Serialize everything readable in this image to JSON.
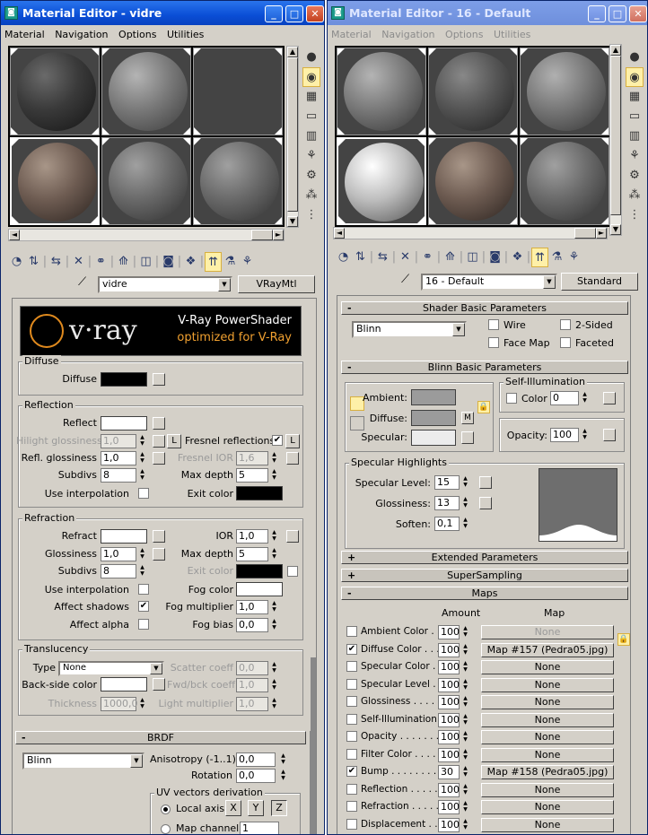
{
  "left": {
    "title": "Material Editor - vidre",
    "menu": [
      "Material",
      "Navigation",
      "Options",
      "Utilities"
    ],
    "material_name": "vidre",
    "material_type": "VRayMtl",
    "banner": {
      "logo": "v·ray",
      "title": "V-Ray PowerShader",
      "subtitle": "optimized for V-Ray"
    },
    "diffuse": {
      "group": "Diffuse",
      "label": "Diffuse"
    },
    "reflection": {
      "group": "Reflection",
      "reflect": "Reflect",
      "hilight_label": "Hilight glossiness",
      "hilight_value": "1,0",
      "refl_label": "Refl. glossiness",
      "refl_value": "1,0",
      "subdivs_label": "Subdivs",
      "subdivs_value": "8",
      "use_interp": "Use interpolation",
      "fresnel": "Fresnel reflections",
      "fresnel_ior_label": "Fresnel IOR",
      "fresnel_ior_value": "1,6",
      "max_depth_label": "Max depth",
      "max_depth_value": "5",
      "exit_color": "Exit color",
      "lock_l": "L"
    },
    "refraction": {
      "group": "Refraction",
      "refract": "Refract",
      "ior_label": "IOR",
      "ior_value": "1,0",
      "gloss_label": "Glossiness",
      "gloss_value": "1,0",
      "max_depth_label": "Max depth",
      "max_depth_value": "5",
      "subdivs_label": "Subdivs",
      "subdivs_value": "8",
      "exit_color": "Exit color",
      "use_interp": "Use interpolation",
      "fog_color": "Fog color",
      "affect_shadows": "Affect shadows",
      "fog_mult_label": "Fog multiplier",
      "fog_mult_value": "1,0",
      "affect_alpha": "Affect alpha",
      "fog_bias_label": "Fog bias",
      "fog_bias_value": "0,0"
    },
    "translucency": {
      "group": "Translucency",
      "type_label": "Type",
      "type_value": "None",
      "scatter_label": "Scatter coeff",
      "scatter_value": "0,0",
      "backside_label": "Back-side color",
      "fwd_label": "Fwd/bck coeff",
      "fwd_value": "1,0",
      "thickness_label": "Thickness",
      "thickness_value": "1000,0",
      "light_mult_label": "Light multiplier",
      "light_mult_value": "1,0"
    },
    "brdf": {
      "header": "BRDF",
      "toggle": "-",
      "type_value": "Blinn",
      "aniso_label": "Anisotropy (-1..1)",
      "aniso_value": "0,0",
      "rotation_label": "Rotation",
      "rotation_value": "0,0",
      "uv_group": "UV vectors derivation",
      "local_axis": "Local axis",
      "x": "X",
      "y": "Y",
      "z": "Z",
      "map_channel": "Map channel",
      "map_channel_value": "1"
    }
  },
  "right": {
    "title": "Material Editor - 16 - Default",
    "menu": [
      "Material",
      "Navigation",
      "Options",
      "Utilities"
    ],
    "material_name": "16 - Default",
    "material_type": "Standard",
    "shader": {
      "header": "Shader Basic Parameters",
      "toggle": "-",
      "value": "Blinn",
      "wire": "Wire",
      "two_sided": "2-Sided",
      "face_map": "Face Map",
      "faceted": "Faceted"
    },
    "blinn": {
      "header": "Blinn Basic Parameters",
      "toggle": "-",
      "self_illum_group": "Self-Illumination",
      "ambient": "Ambient:",
      "diffuse": "Diffuse:",
      "specular": "Specular:",
      "m": "M",
      "color_label": "Color",
      "color_value": "0",
      "opacity_label": "Opacity:",
      "opacity_value": "100"
    },
    "spec": {
      "group": "Specular Highlights",
      "level_label": "Specular Level:",
      "level_value": "15",
      "gloss_label": "Glossiness:",
      "gloss_value": "13",
      "soften_label": "Soften:",
      "soften_value": "0,1"
    },
    "extended": {
      "header": "Extended Parameters",
      "toggle": "+"
    },
    "supersampling": {
      "header": "SuperSampling",
      "toggle": "+"
    },
    "maps": {
      "header": "Maps",
      "toggle": "-",
      "amount_header": "Amount",
      "map_header": "Map",
      "rows": [
        {
          "label": "Ambient Color . . .",
          "amount": "100",
          "map": "None",
          "checked": false
        },
        {
          "label": "Diffuse Color . . .",
          "amount": "100",
          "map": "Map #157 (Pedra05.jpg)",
          "checked": true
        },
        {
          "label": "Specular Color . . .",
          "amount": "100",
          "map": "None",
          "checked": false
        },
        {
          "label": "Specular Level . .",
          "amount": "100",
          "map": "None",
          "checked": false
        },
        {
          "label": "Glossiness . . . . .",
          "amount": "100",
          "map": "None",
          "checked": false
        },
        {
          "label": "Self-Illumination . .",
          "amount": "100",
          "map": "None",
          "checked": false
        },
        {
          "label": "Opacity . . . . . . .",
          "amount": "100",
          "map": "None",
          "checked": false
        },
        {
          "label": "Filter Color . . . .",
          "amount": "100",
          "map": "None",
          "checked": false
        },
        {
          "label": "Bump . . . . . . . . .",
          "amount": "30",
          "map": "Map #158 (Pedra05.jpg)",
          "checked": true
        },
        {
          "label": "Reflection . . . . .",
          "amount": "100",
          "map": "None",
          "checked": false
        },
        {
          "label": "Refraction . . . . .",
          "amount": "100",
          "map": "None",
          "checked": false
        },
        {
          "label": "Displacement . .",
          "amount": "100",
          "map": "None",
          "checked": false
        }
      ]
    }
  },
  "common": {
    "check_mark": "✔",
    "minimize": "_",
    "maximize": "□",
    "close": "✕",
    "spin_up": "▲",
    "spin_down": "▼",
    "dd_arrow": "▼",
    "left_arrow": "◄",
    "right_arrow": "►",
    "lock_icon": "🔒",
    "dropper_icon": "⟋"
  }
}
